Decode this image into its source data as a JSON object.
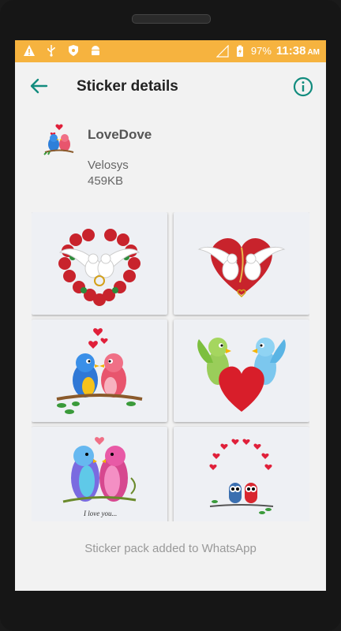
{
  "status_bar": {
    "battery": "97%",
    "time": "11:38",
    "ampm": "AM",
    "icons": [
      "warning-icon",
      "usb-icon",
      "shield-icon",
      "android-icon",
      "signal-icon",
      "battery-charging-icon"
    ]
  },
  "app_bar": {
    "title": "Sticker details",
    "back_icon": "arrow-back-icon",
    "info_icon": "info-icon"
  },
  "pack": {
    "name": "LoveDove",
    "publisher": "Velosys",
    "size": "459KB"
  },
  "stickers": [
    {
      "name": "doves-roses-heart"
    },
    {
      "name": "doves-red-heart"
    },
    {
      "name": "lovebirds-on-branch"
    },
    {
      "name": "birds-with-heart"
    },
    {
      "name": "parrots-i-love-you",
      "caption": "I love you..."
    },
    {
      "name": "owls-under-hearts"
    }
  ],
  "footer": {
    "message": "Sticker pack added to WhatsApp"
  },
  "colors": {
    "status_bar": "#f6b33f",
    "accent": "#128c7e",
    "background": "#f2f2f2"
  }
}
